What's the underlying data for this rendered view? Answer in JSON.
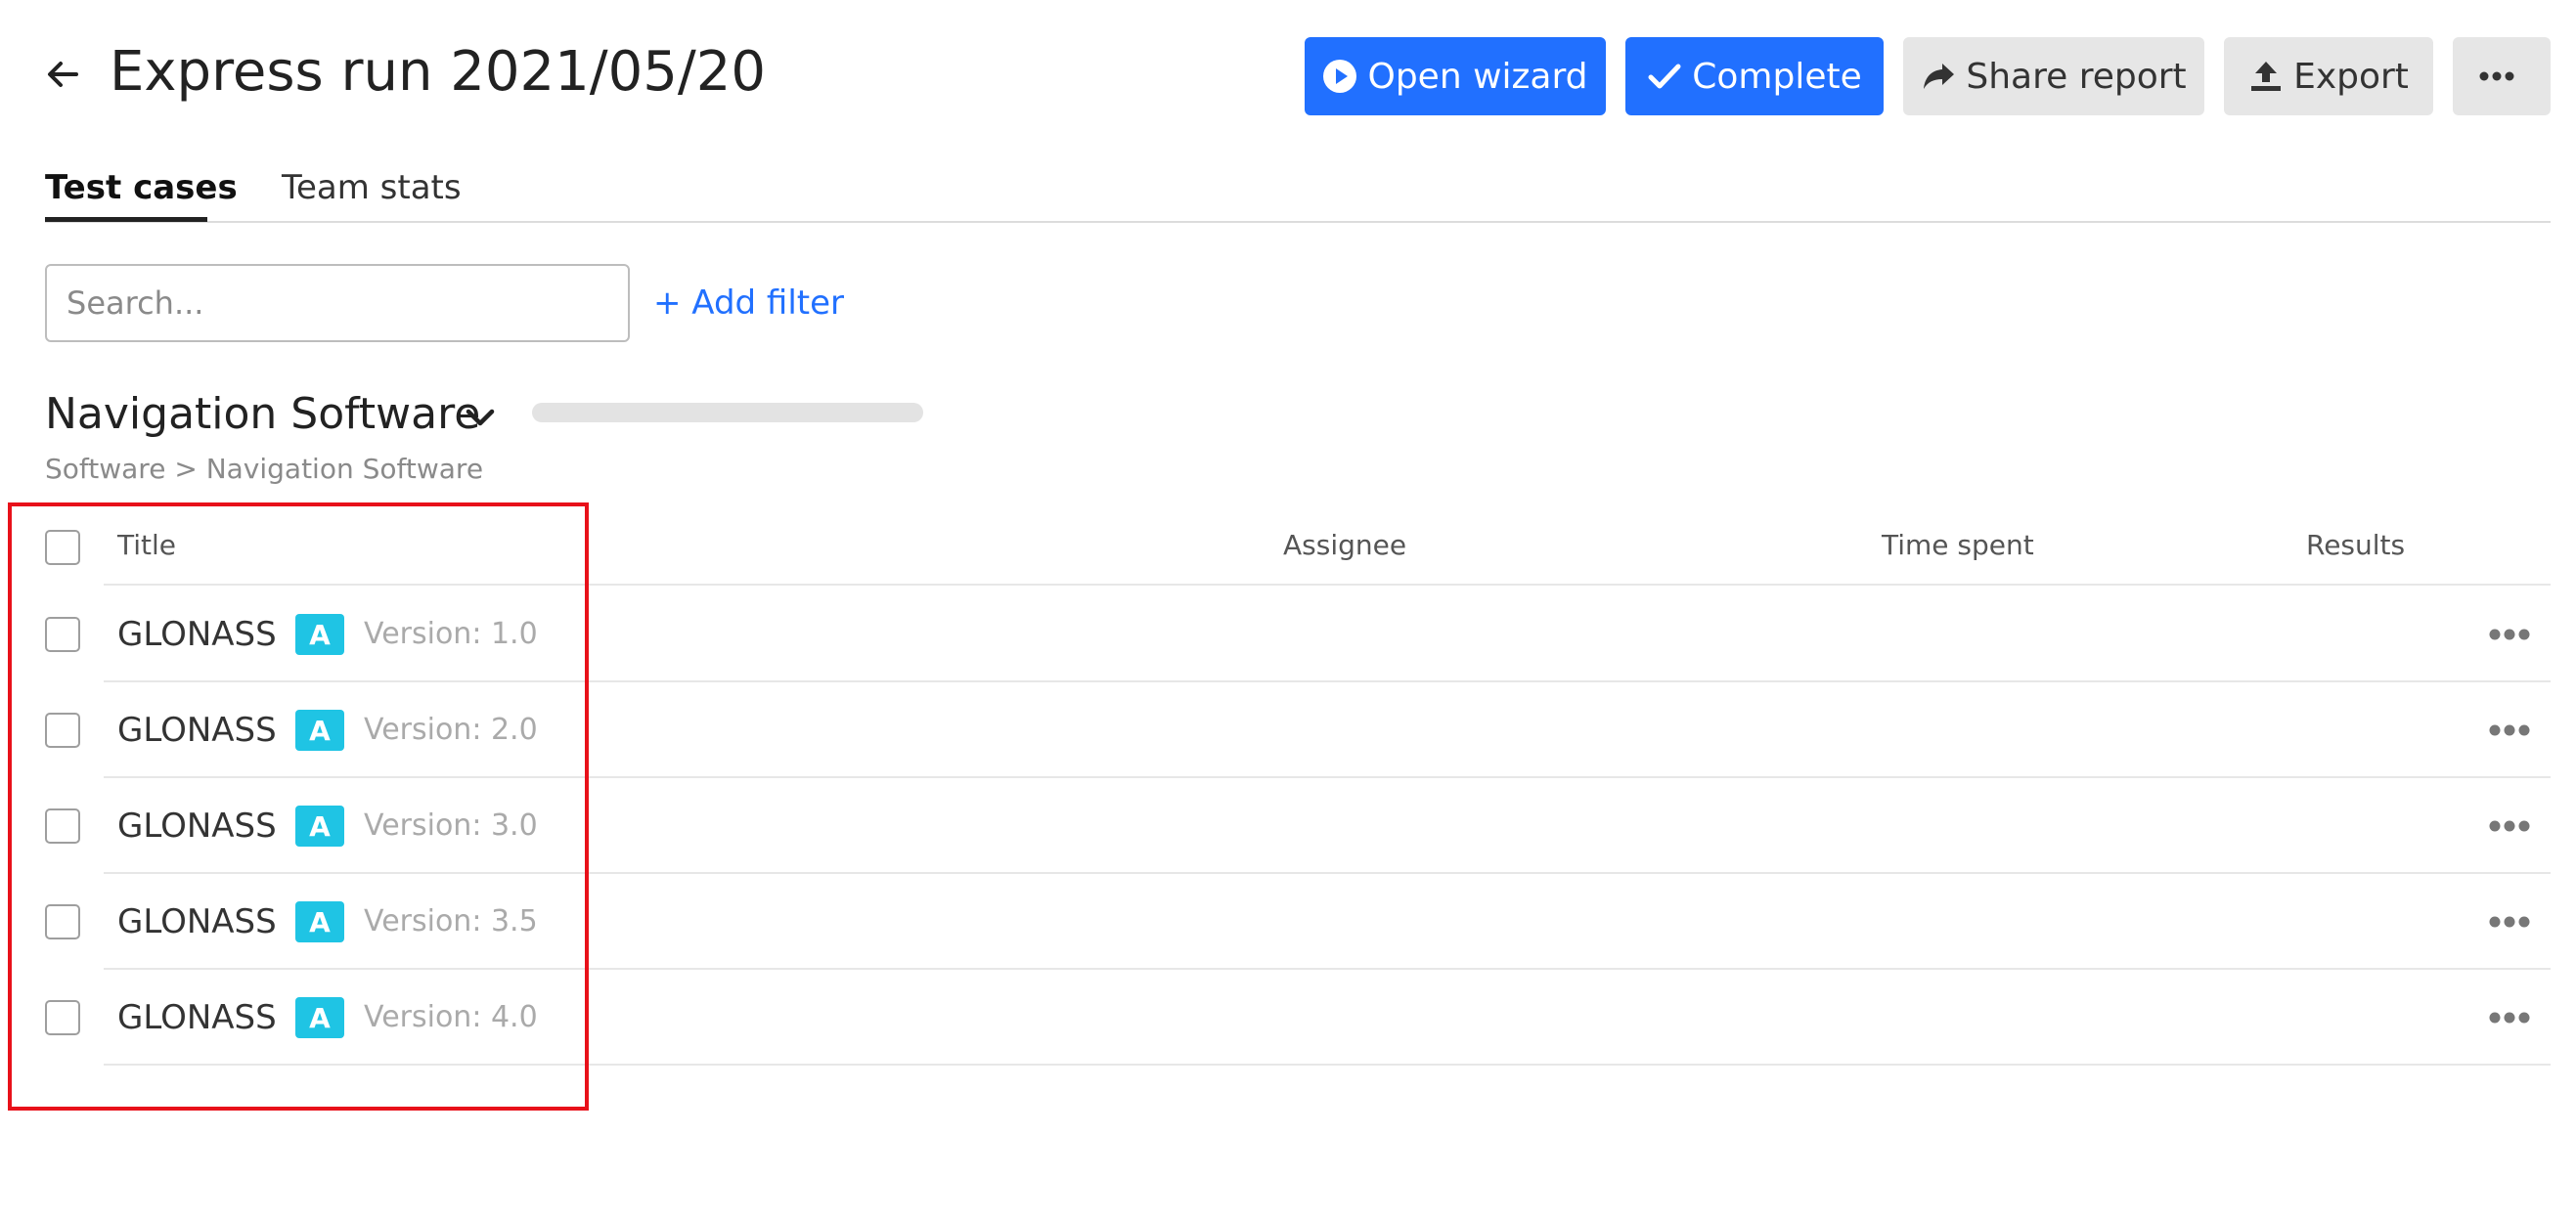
{
  "header": {
    "title": "Express run 2021/05/20",
    "back_icon": "arrow-left-icon"
  },
  "toolbar": {
    "open_wizard_label": "Open wizard",
    "open_wizard_icon": "play-circle-icon",
    "complete_label": "Complete",
    "complete_icon": "check-icon",
    "share_report_label": "Share report",
    "share_report_icon": "share-arrow-icon",
    "export_label": "Export",
    "export_icon": "upload-icon",
    "more_icon": "more-horizontal-icon",
    "primary_color": "#2170ff",
    "secondary_color": "#e6e6e6"
  },
  "tabs": [
    {
      "label": "Test cases",
      "active": true
    },
    {
      "label": "Team stats",
      "active": false
    }
  ],
  "search": {
    "placeholder": "Search...",
    "value": ""
  },
  "add_filter_label": "+ Add filter",
  "group": {
    "title": "Navigation Software",
    "progress": 0,
    "breadcrumb": "Software > Navigation Software"
  },
  "table": {
    "columns": {
      "title": "Title",
      "assignee": "Assignee",
      "time_spent": "Time spent",
      "results": "Results"
    },
    "rows": [
      {
        "title": "GLONASS",
        "badge": "A",
        "version": "Version: 1.0"
      },
      {
        "title": "GLONASS",
        "badge": "A",
        "version": "Version: 2.0"
      },
      {
        "title": "GLONASS",
        "badge": "A",
        "version": "Version: 3.0"
      },
      {
        "title": "GLONASS",
        "badge": "A",
        "version": "Version: 3.5"
      },
      {
        "title": "GLONASS",
        "badge": "A",
        "version": "Version: 4.0"
      }
    ],
    "badge_color": "#1fc4e4"
  },
  "highlight_color": "#e8111a"
}
